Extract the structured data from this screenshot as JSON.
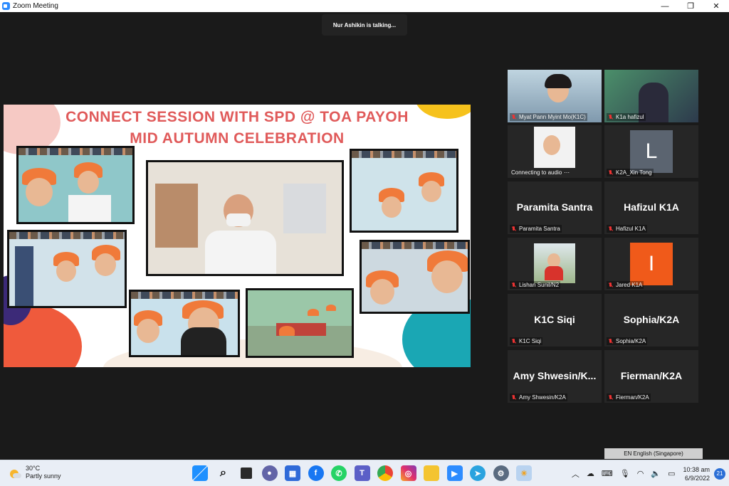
{
  "window": {
    "title": "Zoom Meeting",
    "minimize": "—",
    "restore": "❐",
    "close": "✕"
  },
  "status": {
    "talking": "Nur Ashikin is talking..."
  },
  "share": {
    "title_line1": "CONNECT SESSION WITH SPD @ TOA PAYOH",
    "title_line2": "MID AUTUMN CELEBRATION"
  },
  "participants": [
    {
      "name": "Myat Pann Myint Mo(K1C)",
      "type": "video"
    },
    {
      "name": "K1a hafizul",
      "type": "video"
    },
    {
      "name": "Connecting to audio",
      "type": "video"
    },
    {
      "name": "K2A_Xin Tong",
      "type": "avatar",
      "initial": "L",
      "color": "#5b6470"
    },
    {
      "name": "Paramita Santra",
      "type": "name",
      "display": "Paramita Santra"
    },
    {
      "name": "Hafizul K1A",
      "type": "name",
      "display": "Hafizul K1A"
    },
    {
      "name": "Lishan Sunil/N2",
      "type": "video"
    },
    {
      "name": "Jared K1A",
      "type": "avatar",
      "initial": "I",
      "color": "#f05a1a"
    },
    {
      "name": "K1C Siqi",
      "type": "name",
      "display": "K1C Siqi"
    },
    {
      "name": "Sophia/K2A",
      "type": "name",
      "display": "Sophia/K2A"
    },
    {
      "name": "Amy Shwesin/K2A",
      "type": "name",
      "display": "Amy  Shwesin/K..."
    },
    {
      "name": "Fierman/K2A",
      "type": "name",
      "display": "Fierman/K2A"
    }
  ],
  "language_bar": "EN English (Singapore)",
  "taskbar": {
    "weather_temp": "30°C",
    "weather_desc": "Partly sunny",
    "time": "10:38 am",
    "date": "6/9/2022",
    "notifications": "21"
  }
}
